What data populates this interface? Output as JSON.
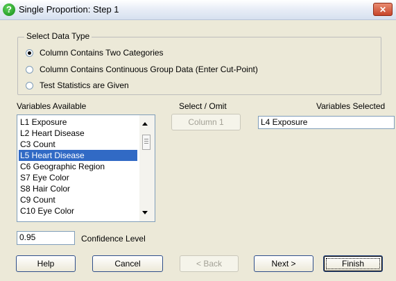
{
  "window": {
    "title": "Single Proportion: Step 1",
    "close_glyph": "✕"
  },
  "data_type": {
    "legend": "Select Data Type",
    "options": [
      {
        "label": "Column Contains Two Categories",
        "checked": true
      },
      {
        "label": "Column Contains Continuous Group Data (Enter Cut-Point)",
        "checked": false
      },
      {
        "label": "Test Statistics are Given",
        "checked": false
      }
    ]
  },
  "variables_available": {
    "label": "Variables Available",
    "items": [
      "L1 Exposure",
      "L2 Heart Disease",
      "C3 Count",
      "L5 Heart Disease",
      "C6 Geographic Region",
      "S7 Eye Color",
      "S8 Hair Color",
      "C9 Count",
      "C10 Eye Color"
    ],
    "selected_index": 3
  },
  "select_omit": {
    "label": "Select / Omit",
    "button_label": "Column 1"
  },
  "variables_selected": {
    "label": "Variables Selected",
    "value": "L4 Exposure"
  },
  "confidence": {
    "value": "0.95",
    "label": "Confidence Level"
  },
  "buttons": {
    "help": "Help",
    "cancel": "Cancel",
    "back": "< Back",
    "next": "Next >",
    "finish": "Finish"
  },
  "colors": {
    "selection": "#316ac5",
    "dialog_bg": "#ece9d8"
  },
  "icons": {
    "title": "help-question-icon"
  }
}
